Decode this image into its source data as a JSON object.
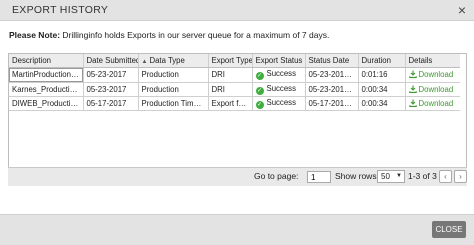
{
  "header": {
    "title": "EXPORT HISTORY",
    "close_glyph": "×"
  },
  "note": {
    "prefix": "Please Note:",
    "text": " Drillinginfo holds Exports in our server queue for a maximum of 7 days."
  },
  "table": {
    "sort_indicator": "▲",
    "columns": [
      "Description",
      "Date Submitted",
      "Data Type",
      "Export Type",
      "Export Status",
      "Status Date",
      "Duration",
      "Details"
    ],
    "rows": [
      {
        "description": "MartinProduction D...",
        "date_submitted": "05-23-2017",
        "data_type": "Production",
        "export_type": "DRI",
        "status": "Success",
        "status_date": "05-23-2017...",
        "duration": "0:01:16",
        "details": "Download"
      },
      {
        "description": "Karnes_Production...",
        "date_submitted": "05-23-2017",
        "data_type": "Production",
        "export_type": "DRI",
        "status": "Success",
        "status_date": "05-23-2017...",
        "duration": "0:00:34",
        "details": "Download"
      },
      {
        "description": "DIWEB_Production...",
        "date_submitted": "05-17-2017",
        "data_type": "Production Time ...",
        "export_type": "Export for...",
        "status": "Success",
        "status_date": "05-17-2017...",
        "duration": "0:00:34",
        "details": "Download"
      }
    ]
  },
  "pager": {
    "goto_label": "Go to page:",
    "page_value": "1",
    "rows_label": "Show rows:",
    "rows_value": "50",
    "range": "1-3 of 3",
    "prev_glyph": "‹",
    "next_glyph": "›"
  },
  "footer": {
    "close_label": "CLOSE"
  },
  "colors": {
    "success": "#3fae3f",
    "download": "#3d9a2f",
    "header_bg": "#e3e3e3",
    "close_btn": "#777777"
  }
}
